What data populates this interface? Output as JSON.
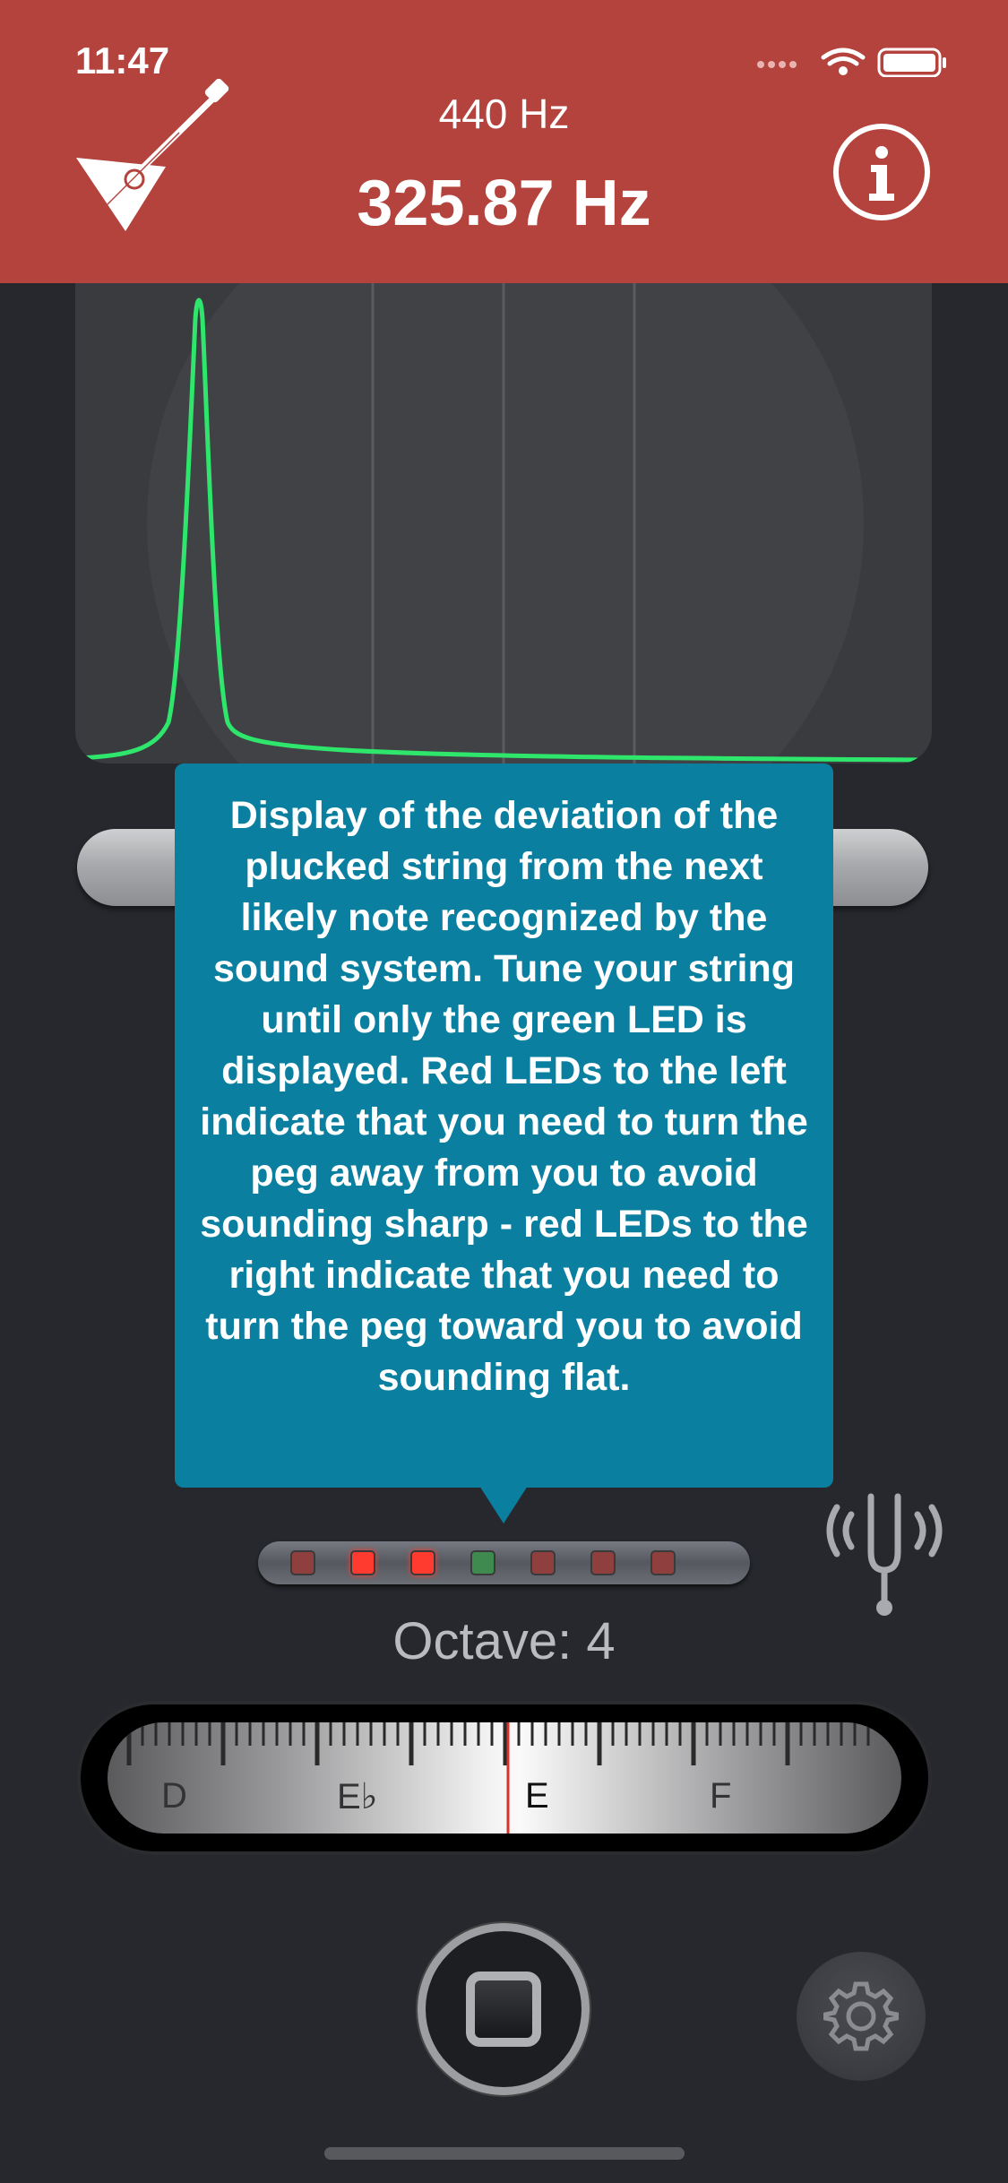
{
  "status_bar": {
    "time": "11:47"
  },
  "header": {
    "reference_frequency": "440 Hz",
    "detected_frequency": "325.87 Hz",
    "logo_icon": "balalaika-icon",
    "info_icon": "info-icon"
  },
  "tooltip": {
    "text": "Display of the deviation of the plucked string from the next likely note recognized by the sound system. Tune your string until only the green LED  is displayed. Red LEDs to the left indicate that you need to turn the peg away from you to avoid sounding sharp - red LEDs to the right indicate that you need to turn the peg toward you to avoid sounding flat."
  },
  "leds": [
    {
      "color": "#8f3f3d",
      "lit": false
    },
    {
      "color": "#ff3b30",
      "lit": true
    },
    {
      "color": "#ff3b30",
      "lit": true
    },
    {
      "color": "#3f8a4e",
      "lit": false
    },
    {
      "color": "#8f3f3d",
      "lit": false
    },
    {
      "color": "#8f3f3d",
      "lit": false
    },
    {
      "color": "#8f3f3d",
      "lit": false
    }
  ],
  "octave_label": "Octave: 4",
  "note_scale": {
    "notes": [
      "D",
      "E♭",
      "E",
      "F"
    ],
    "current_note": "E"
  },
  "controls": {
    "stop_icon": "stop-icon",
    "settings_icon": "gear-icon",
    "tuning_fork_icon": "tuning-fork-icon"
  },
  "colors": {
    "header_bg": "#b3433c",
    "tooltip_bg": "#0a7f9f",
    "spectrum_line": "#2ee66b",
    "needle": "#d8322a"
  }
}
